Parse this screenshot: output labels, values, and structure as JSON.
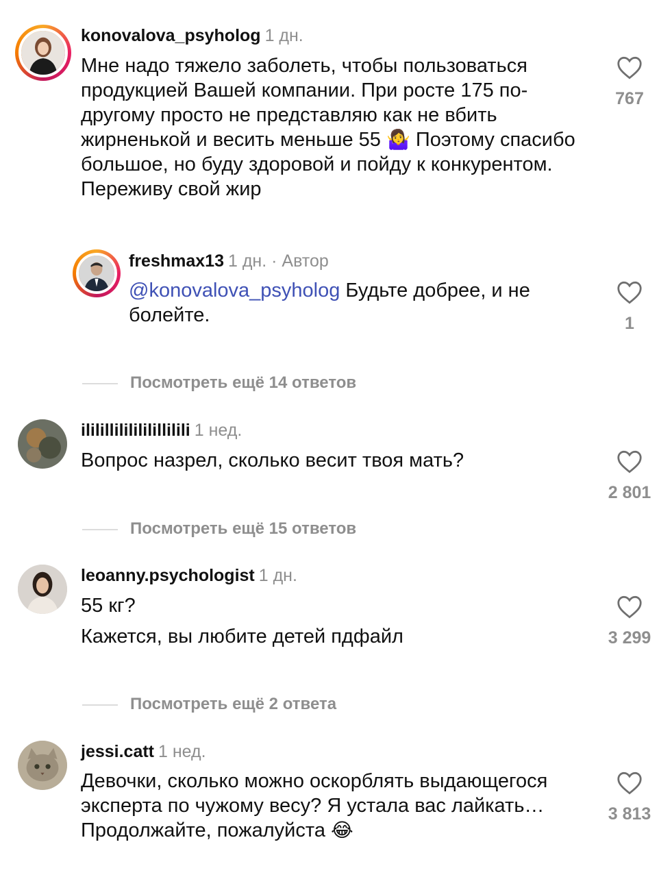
{
  "comments": [
    {
      "username": "konovalova_psyholog",
      "time": "1 дн.",
      "text": "Мне надо тяжело заболеть, чтобы пользоваться продукцией Вашей компании. При росте 175 по-другому просто не представляю как не вбить жирненькой и весить меньше 55",
      "emoji": "🤷‍♀️",
      "text2": " Поэтому спасибо  большое, но буду здоровой и пойду к конкурентом. Переживу свой жир",
      "likes": "767"
    },
    {
      "username": "freshmax13",
      "time": "1 дн.",
      "author_label": " · Автор",
      "mention": "@konovalova_psyholog",
      "text": " Будьте добрее, и не болейте.",
      "likes": "1"
    },
    {
      "username": "ililillililililillilili",
      "time": "1 нед.",
      "text": "Вопрос назрел,  сколько весит твоя мать?",
      "likes": "2 801"
    },
    {
      "username": "leoanny.psychologist",
      "time": "1 дн.",
      "line1": "55 кг?",
      "line2": "Кажется, вы любите детей пдфайл",
      "likes": "3 299"
    },
    {
      "username": "jessi.catt",
      "time": "1 нед.",
      "text": "Девочки, сколько можно оскорблять выдающегося эксперта по чужому весу? Я устала вас лайкать…Продолжайте, пожалуйста ",
      "emoji": "😂",
      "likes": "3 813"
    }
  ],
  "view_more": [
    "Посмотреть ещё 14 ответов",
    "Посмотреть ещё 15 ответов",
    "Посмотреть ещё 2 ответа"
  ]
}
